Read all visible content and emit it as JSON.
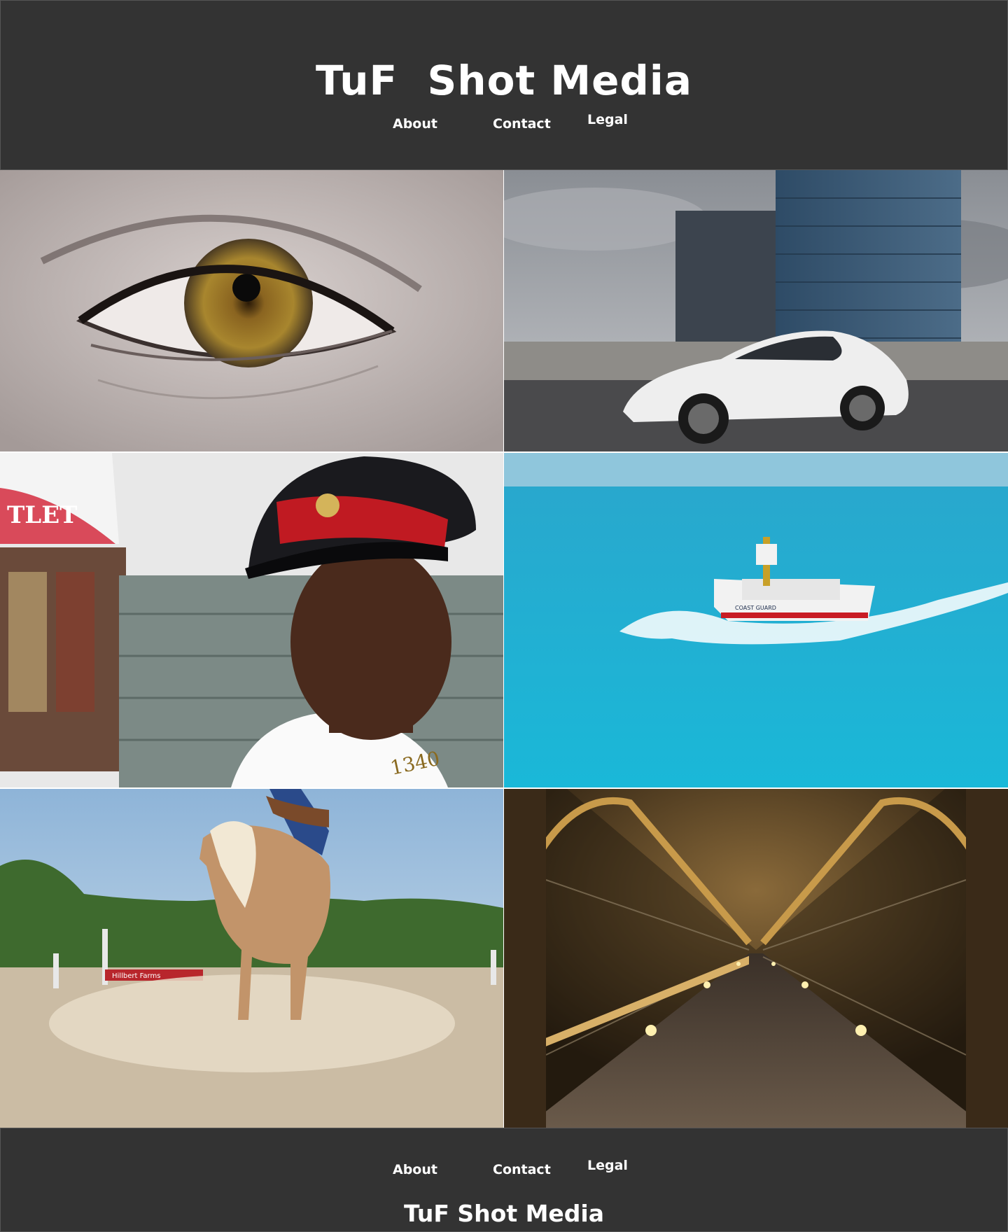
{
  "header": {
    "title": "TuF  Shot Media",
    "nav": {
      "about": "About",
      "contact": "Contact",
      "legal": "Legal"
    }
  },
  "gallery": {
    "images": [
      {
        "subject": "eye-closeup"
      },
      {
        "subject": "white-sports-car-office-tower"
      },
      {
        "subject": "soldier-portrait"
      },
      {
        "subject": "coast-guard-boat-ocean"
      },
      {
        "subject": "horse-rider-dust"
      },
      {
        "subject": "lit-bridge-night"
      }
    ],
    "soldier_badge_number": "1340",
    "storefront_sign": "TLET",
    "boat_hull_text": "COAST GUARD",
    "fence_banner_text": "Hillbert Farms"
  },
  "footer": {
    "nav": {
      "about": "About",
      "contact": "Contact",
      "legal": "Legal"
    },
    "title": "TuF Shot Media"
  },
  "colors": {
    "bar_background": "#333333",
    "text": "#ffffff"
  }
}
